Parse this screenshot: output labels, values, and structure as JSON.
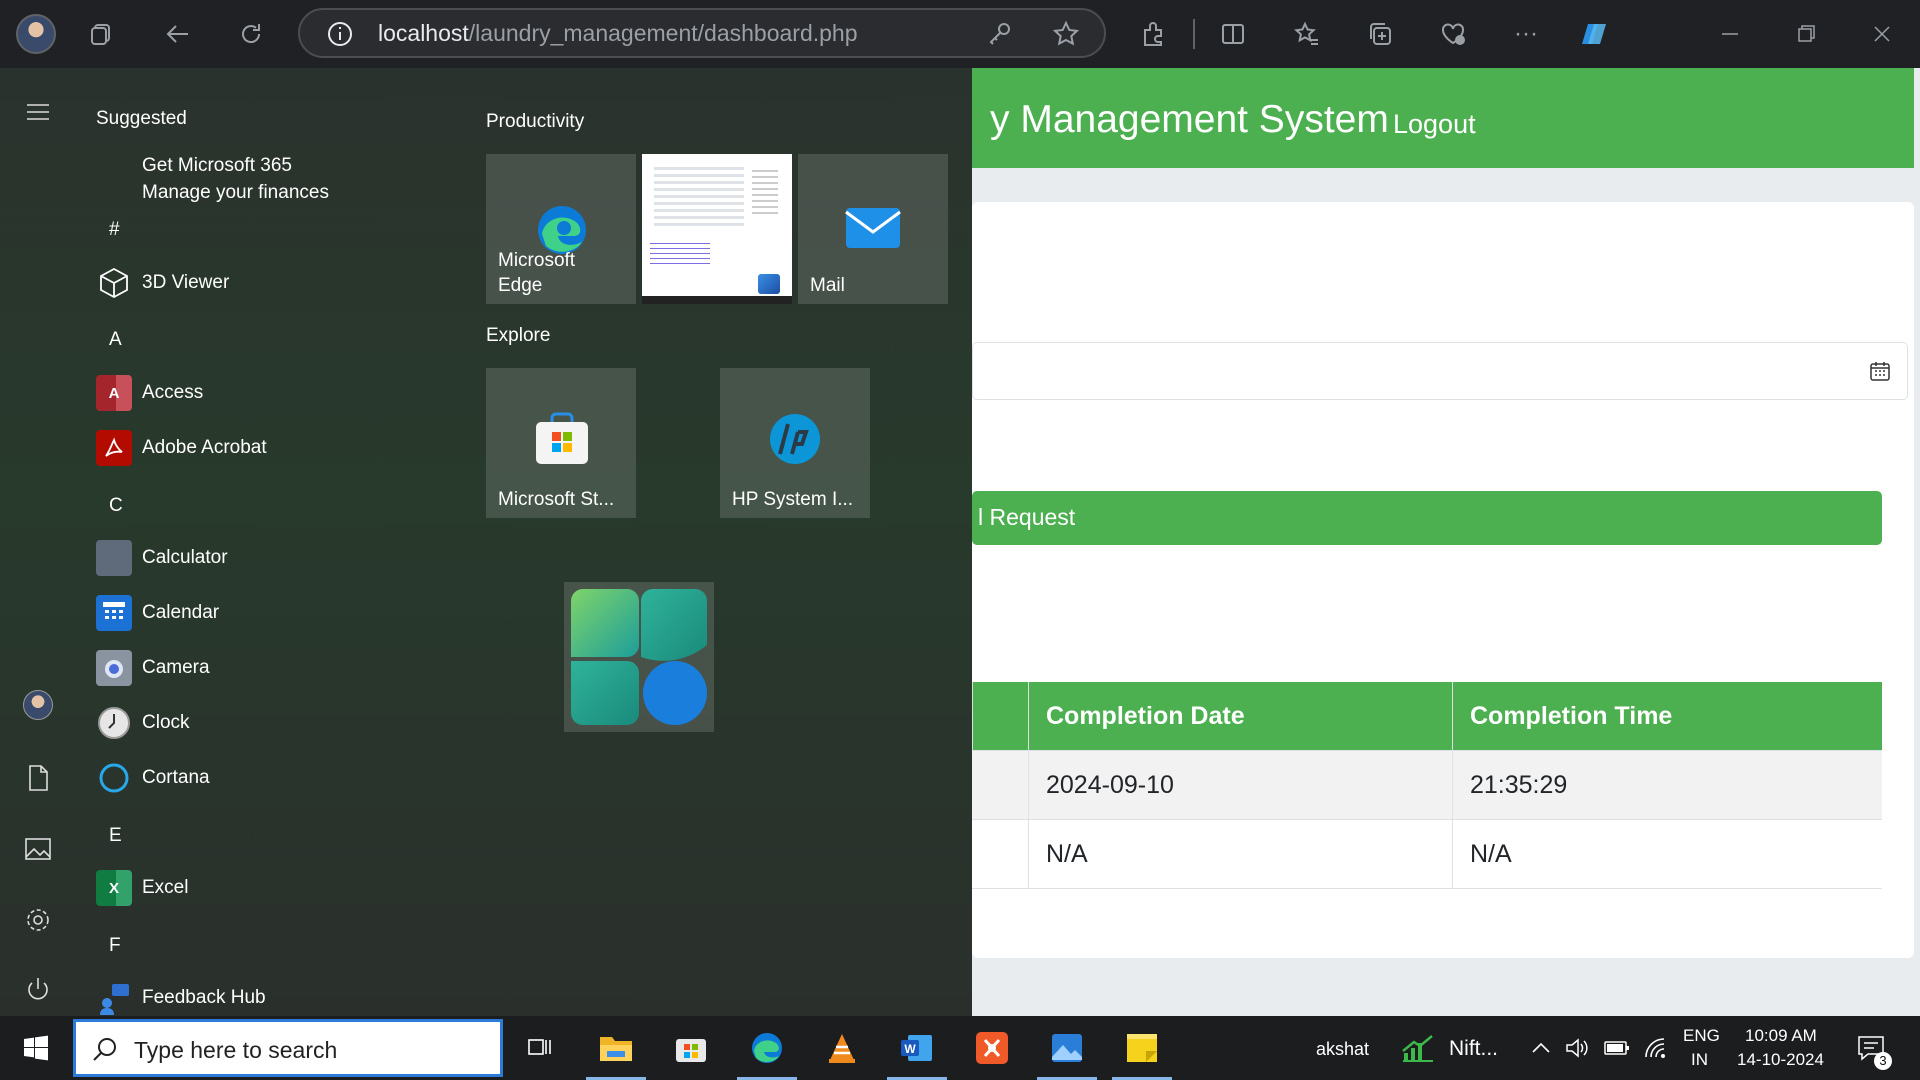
{
  "browser": {
    "url_host": "localhost",
    "url_path": "/laundry_management/dashboard.php",
    "more_label": "···"
  },
  "page": {
    "header_title": "y Management System",
    "logout": "Logout",
    "request_button": "l Request",
    "table": {
      "headers": [
        "",
        "Completion Date",
        "Completion Time"
      ],
      "rows": [
        [
          "",
          "2024-09-10",
          "21:35:29"
        ],
        [
          "",
          "N/A",
          "N/A"
        ]
      ]
    },
    "accent": "#4caf50"
  },
  "start_menu": {
    "suggested_title": "Suggested",
    "suggested": {
      "title": "Get Microsoft 365",
      "subtitle": "Manage your finances"
    },
    "letters": [
      "#",
      "A",
      "C",
      "E",
      "F"
    ],
    "apps": [
      {
        "label": "3D Viewer",
        "icon": "cube-icon"
      },
      {
        "label": "Access",
        "icon": "access-icon"
      },
      {
        "label": "Adobe Acrobat",
        "icon": "acrobat-icon"
      },
      {
        "label": "Calculator",
        "icon": "calculator-icon"
      },
      {
        "label": "Calendar",
        "icon": "calendar-icon"
      },
      {
        "label": "Camera",
        "icon": "camera-icon"
      },
      {
        "label": "Clock",
        "icon": "clock-icon"
      },
      {
        "label": "Cortana",
        "icon": "cortana-icon"
      },
      {
        "label": "Excel",
        "icon": "excel-icon"
      },
      {
        "label": "Feedback Hub",
        "icon": "feedback-icon"
      }
    ],
    "groups": {
      "productivity": "Productivity",
      "explore": "Explore"
    },
    "tiles": {
      "edge": "Microsoft\nEdge",
      "mail": "Mail",
      "store": "Microsoft St...",
      "hp": "HP System I..."
    }
  },
  "taskbar": {
    "search_placeholder": "Type here to search",
    "user": "akshat",
    "stock": "Nift...",
    "lang_top": "ENG",
    "lang_bottom": "IN",
    "time": "10:09 AM",
    "date": "14-10-2024",
    "notifications": "3"
  }
}
